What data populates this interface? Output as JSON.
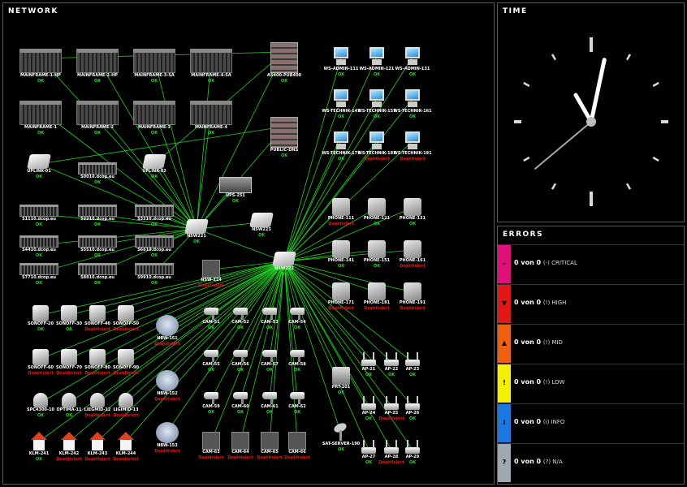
{
  "panels": {
    "network": "NETWORK",
    "time": "TIME",
    "errors": "ERRORS"
  },
  "colors": {
    "ok": "#14e014",
    "down": "#e01818",
    "link": "#1fd01f"
  },
  "clock": {
    "hour_hand": "11:00",
    "minute_hand": "05",
    "second_hand": "38"
  },
  "nodes": [
    {
      "id": "MAINFRAME-1-HP",
      "label": "MAINFRAME-1-HP",
      "status": "OK",
      "icon": "mainframe"
    },
    {
      "id": "MAINFRAME-2-HP",
      "label": "MAINFRAME-2-HP",
      "status": "OK",
      "icon": "mainframe"
    },
    {
      "id": "MAINFRAME-3-SA",
      "label": "MAINFRAME-3-SA",
      "status": "OK",
      "icon": "mainframe"
    },
    {
      "id": "MAINFRAME-4-SA",
      "label": "MAINFRAME-4-SA",
      "status": "OK",
      "icon": "mainframe"
    },
    {
      "id": "MAINFRAME-1",
      "label": "MAINFRAME-1",
      "status": "OK",
      "icon": "mainframe"
    },
    {
      "id": "MAINFRAME-2",
      "label": "MAINFRAME-2",
      "status": "OK",
      "icon": "mainframe"
    },
    {
      "id": "MAINFRAME-3",
      "label": "MAINFRAME-3",
      "status": "OK",
      "icon": "mainframe"
    },
    {
      "id": "MAINFRAME-4",
      "label": "MAINFRAME-4",
      "status": "OK",
      "icon": "mainframe"
    },
    {
      "id": "AS400-PUB400",
      "label": "AS400-PUB400",
      "status": "OK",
      "icon": "storage"
    },
    {
      "id": "PUBLIC-DNS",
      "label": "PUBLIC-DNS",
      "status": "OK",
      "icon": "storage"
    },
    {
      "id": "UPLINK-01",
      "label": "UPLINK-01",
      "status": "OK",
      "icon": "switch"
    },
    {
      "id": "UPLINK-02",
      "label": "UPLINK-02",
      "status": "OK",
      "icon": "switch"
    },
    {
      "id": "S0010",
      "label": "S0010.dcop.eu",
      "status": "OK",
      "icon": "rack"
    },
    {
      "id": "UPS-251",
      "label": "UPS-251",
      "status": "OK",
      "icon": "ups"
    },
    {
      "id": "S1110",
      "label": "S1110.dcop.eu",
      "status": "OK",
      "icon": "rack"
    },
    {
      "id": "S2210",
      "label": "S2210.dcop.eu",
      "status": "OK",
      "icon": "rack"
    },
    {
      "id": "S3310",
      "label": "S3310.dcop.eu",
      "status": "OK",
      "icon": "rack"
    },
    {
      "id": "S4410",
      "label": "S4410.dcop.eu",
      "status": "OK",
      "icon": "rack"
    },
    {
      "id": "S5510",
      "label": "S5510.dcop.eu",
      "status": "OK",
      "icon": "rack"
    },
    {
      "id": "S6610",
      "label": "S6610.dcop.eu",
      "status": "OK",
      "icon": "rack"
    },
    {
      "id": "S7710",
      "label": "S7710.dcop.eu",
      "status": "OK",
      "icon": "rack"
    },
    {
      "id": "S8810",
      "label": "S8810.dcop.eu",
      "status": "OK",
      "icon": "rack"
    },
    {
      "id": "S9910",
      "label": "S9910.dcop.eu",
      "status": "OK",
      "icon": "rack"
    },
    {
      "id": "NSW221",
      "label": "NSW221",
      "status": "OK",
      "icon": "switch"
    },
    {
      "id": "NSW223",
      "label": "NSW223",
      "status": "OK",
      "icon": "switch"
    },
    {
      "id": "NSW222",
      "label": "NSW222",
      "status": "OK",
      "icon": "switch"
    },
    {
      "id": "NSW-224",
      "label": "NSW-224",
      "status": "Deaktiviert",
      "icon": "tile"
    },
    {
      "id": "WS-ADMIN-111",
      "label": "WS-ADMIN-111",
      "status": "OK",
      "icon": "ws"
    },
    {
      "id": "WS-ADMIN-121",
      "label": "WS-ADMIN-121",
      "status": "OK",
      "icon": "ws"
    },
    {
      "id": "WS-ADMIN-131",
      "label": "WS-ADMIN-131",
      "status": "OK",
      "icon": "ws"
    },
    {
      "id": "WS-TECHNIK-141",
      "label": "WS-TECHNIK-141",
      "status": "OK",
      "icon": "ws"
    },
    {
      "id": "WS-TECHNIK-151",
      "label": "WS-TECHNIK-151",
      "status": "OK",
      "icon": "ws"
    },
    {
      "id": "WS-TECHNIK-161",
      "label": "WS-TECHNIK-161",
      "status": "OK",
      "icon": "ws"
    },
    {
      "id": "WS-TECHNIK-171",
      "label": "WS-TECHNIK-171",
      "status": "OK",
      "icon": "ws"
    },
    {
      "id": "WS-TECHNIK-181",
      "label": "WS-TECHNIK-181",
      "status": "Deaktiviert",
      "icon": "ws"
    },
    {
      "id": "WS-TECHNIK-191",
      "label": "WS-TECHNIK-191",
      "status": "Deaktiviert",
      "icon": "ws"
    },
    {
      "id": "PHONE-111",
      "label": "PHONE-111",
      "status": "Deaktiviert",
      "icon": "phone"
    },
    {
      "id": "PHONE-121",
      "label": "PHONE-121",
      "status": "OK",
      "icon": "phone"
    },
    {
      "id": "PHONE-131",
      "label": "PHONE-131",
      "status": "OK",
      "icon": "phone"
    },
    {
      "id": "PHONE-141",
      "label": "PHONE-141",
      "status": "OK",
      "icon": "phone"
    },
    {
      "id": "PHONE-151",
      "label": "PHONE-151",
      "status": "OK",
      "icon": "phone"
    },
    {
      "id": "PHONE-161",
      "label": "PHONE-161",
      "status": "Deaktiviert",
      "icon": "phone"
    },
    {
      "id": "PHONE-171",
      "label": "PHONE-171",
      "status": "Deaktiviert",
      "icon": "phone"
    },
    {
      "id": "PHONE-181",
      "label": "PHONE-181",
      "status": "Deaktiviert",
      "icon": "phone"
    },
    {
      "id": "PHONE-191",
      "label": "PHONE-191",
      "status": "Deaktiviert",
      "icon": "phone"
    },
    {
      "id": "SONOFF-20",
      "label": "SONOFF-20",
      "status": "OK",
      "icon": "sonoff"
    },
    {
      "id": "SONOFF-30",
      "label": "SONOFF-30",
      "status": "OK",
      "icon": "sonoff"
    },
    {
      "id": "SONOFF-40",
      "label": "SONOFF-40",
      "status": "Deaktiviert",
      "icon": "sonoff"
    },
    {
      "id": "SONOFF-50",
      "label": "SONOFF-50",
      "status": "Deaktiviert",
      "icon": "sonoff"
    },
    {
      "id": "SONOFF-60",
      "label": "SONOFF-60",
      "status": "Deaktiviert",
      "icon": "sonoff"
    },
    {
      "id": "SONOFF-70",
      "label": "SONOFF-70",
      "status": "Deaktiviert",
      "icon": "sonoff"
    },
    {
      "id": "SONOFF-80",
      "label": "SONOFF-80",
      "status": "Deaktiviert",
      "icon": "sonoff"
    },
    {
      "id": "SONOFF-90",
      "label": "SONOFF-90",
      "status": "Deaktiviert",
      "icon": "sonoff"
    },
    {
      "id": "SPC4300-10",
      "label": "SPC4300-10",
      "status": "OK",
      "icon": "sensor"
    },
    {
      "id": "OPTIMA-11",
      "label": "OPTIMA-11",
      "status": "OK",
      "icon": "sensor"
    },
    {
      "id": "LIEGMID-12",
      "label": "LIEGMID-12",
      "status": "Deaktiviert",
      "icon": "sensor"
    },
    {
      "id": "LIGIMID-13",
      "label": "LIGIMID-13",
      "status": "Deaktiviert",
      "icon": "sensor"
    },
    {
      "id": "KLM-241",
      "label": "KLM-241",
      "status": "OK",
      "icon": "house"
    },
    {
      "id": "KLM-242",
      "label": "KLM-242",
      "status": "Deaktiviert",
      "icon": "house"
    },
    {
      "id": "KLM-243",
      "label": "KLM-243",
      "status": "Deaktiviert",
      "icon": "house"
    },
    {
      "id": "KLM-244",
      "label": "KLM-244",
      "status": "Deaktiviert",
      "icon": "house"
    },
    {
      "id": "NBW-151",
      "label": "NBW-151",
      "status": "Deaktiviert",
      "icon": "router"
    },
    {
      "id": "NBW-152",
      "label": "NBW-152",
      "status": "Deaktiviert",
      "icon": "router"
    },
    {
      "id": "NBW-153",
      "label": "NBW-153",
      "status": "Deaktiviert",
      "icon": "router"
    },
    {
      "id": "CAM-51",
      "label": "CAM-51",
      "status": "OK",
      "icon": "cam"
    },
    {
      "id": "CAM-52",
      "label": "CAM-52",
      "status": "OK",
      "icon": "cam"
    },
    {
      "id": "CAM-53",
      "label": "CAM-53",
      "status": "OK",
      "icon": "cam"
    },
    {
      "id": "CAM-54",
      "label": "CAM-54",
      "status": "OK",
      "icon": "cam"
    },
    {
      "id": "CAM-55",
      "label": "CAM-55",
      "status": "OK",
      "icon": "cam"
    },
    {
      "id": "CAM-56",
      "label": "CAM-56",
      "status": "OK",
      "icon": "cam"
    },
    {
      "id": "CAM-57",
      "label": "CAM-57",
      "status": "OK",
      "icon": "cam"
    },
    {
      "id": "CAM-58",
      "label": "CAM-58",
      "status": "OK",
      "icon": "cam"
    },
    {
      "id": "CAM-59",
      "label": "CAM-59",
      "status": "OK",
      "icon": "cam"
    },
    {
      "id": "CAM-60",
      "label": "CAM-60",
      "status": "OK",
      "icon": "cam"
    },
    {
      "id": "CAM-61",
      "label": "CAM-61",
      "status": "OK",
      "icon": "cam"
    },
    {
      "id": "CAM-62",
      "label": "CAM-62",
      "status": "OK",
      "icon": "cam"
    },
    {
      "id": "CAM-63",
      "label": "CAM-63",
      "status": "Deaktiviert",
      "icon": "tile"
    },
    {
      "id": "CAM-64",
      "label": "CAM-64",
      "status": "Deaktiviert",
      "icon": "tile"
    },
    {
      "id": "CAM-65",
      "label": "CAM-65",
      "status": "Deaktiviert",
      "icon": "tile"
    },
    {
      "id": "CAM-66",
      "label": "CAM-66",
      "status": "Deaktiviert",
      "icon": "tile"
    },
    {
      "id": "PRT-201",
      "label": "PRT-201",
      "status": "OK",
      "icon": "printer"
    },
    {
      "id": "SAT-SERVER-190",
      "label": "SAT-SERVER-190",
      "status": "OK",
      "icon": "sat"
    },
    {
      "id": "AP-21",
      "label": "AP-21",
      "status": "OK",
      "icon": "ap"
    },
    {
      "id": "AP-22",
      "label": "AP-22",
      "status": "OK",
      "icon": "ap"
    },
    {
      "id": "AP-23",
      "label": "AP-23",
      "status": "OK",
      "icon": "ap"
    },
    {
      "id": "AP-24",
      "label": "AP-24",
      "status": "OK",
      "icon": "ap"
    },
    {
      "id": "AP-25",
      "label": "AP-25",
      "status": "Deaktiviert",
      "icon": "ap"
    },
    {
      "id": "AP-26",
      "label": "AP-26",
      "status": "OK",
      "icon": "ap"
    },
    {
      "id": "AP-27",
      "label": "AP-27",
      "status": "OK",
      "icon": "ap"
    },
    {
      "id": "AP-28",
      "label": "AP-28",
      "status": "Deaktiviert",
      "icon": "ap"
    },
    {
      "id": "AP-29",
      "label": "AP-29",
      "status": "OK",
      "icon": "ap"
    }
  ],
  "errors": [
    {
      "text": "0 von 0",
      "suffix": "(-) CRITICAL",
      "color": "#e0107a",
      "icon": "minus-icon",
      "symbol": "–"
    },
    {
      "text": "0 von 0",
      "suffix": "(!) HIGH",
      "color": "#e01818",
      "icon": "arrow-down-icon",
      "symbol": "▼"
    },
    {
      "text": "0 von 0",
      "suffix": "(!) MID",
      "color": "#f06010",
      "icon": "warning-icon",
      "symbol": "▲"
    },
    {
      "text": "0 von 0",
      "suffix": "(!) LOW",
      "color": "#f4f000",
      "icon": "exclamation-icon",
      "symbol": "!"
    },
    {
      "text": "0 von 0",
      "suffix": "(i) INFO",
      "color": "#1a78e0",
      "icon": "info-icon",
      "symbol": "i"
    },
    {
      "text": "0 von 0",
      "suffix": "(?) N/A",
      "color": "#a0a8b0",
      "icon": "question-icon",
      "symbol": "?"
    }
  ]
}
